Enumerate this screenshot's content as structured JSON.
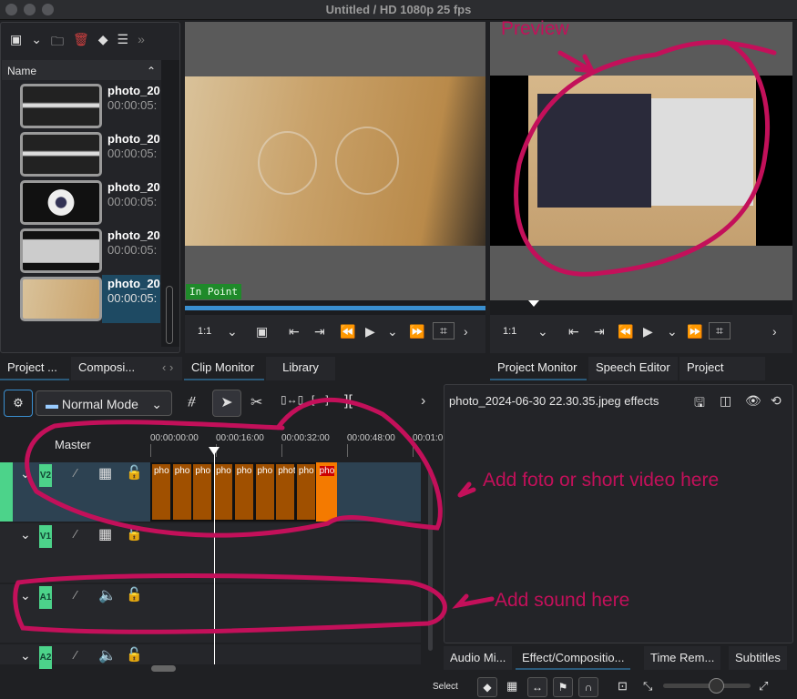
{
  "window": {
    "title": "Untitled / HD 1080p 25 fps"
  },
  "bin": {
    "header": "Name",
    "items": [
      {
        "name": "photo_20",
        "duration": "00:00:05:"
      },
      {
        "name": "photo_20",
        "duration": "00:00:05:"
      },
      {
        "name": "photo_20",
        "duration": "00:00:05:"
      },
      {
        "name": "photo_20",
        "duration": "00:00:05:"
      },
      {
        "name": "photo_20",
        "duration": "00:00:05:",
        "selected": true
      }
    ]
  },
  "left_tabs": [
    "Project ...",
    "Composi...",
    "Clip Monitor",
    "Library"
  ],
  "right_tabs": [
    "Project Monitor",
    "Speech Editor",
    "Project Notes"
  ],
  "clip_monitor": {
    "in_point": "In Point",
    "zoom": "1:1"
  },
  "project_monitor": {
    "zoom": "1:1"
  },
  "timeline": {
    "mode": "Normal Mode",
    "master": "Master",
    "ruler": [
      "00:00:00:00",
      "00:00:16:00",
      "00:00:32:00",
      "00:00:48:00",
      "00:01:0"
    ],
    "tracks": [
      "V2",
      "V1",
      "A1",
      "A2"
    ],
    "clips": [
      "pho",
      "pho",
      "pho",
      "pho",
      "pho",
      "pho",
      "phot",
      "pho",
      "pho"
    ]
  },
  "effects": {
    "title": "photo_2024-06-30 22.30.35.jpeg effects"
  },
  "bottom_tabs": [
    "Audio Mi...",
    "Effect/Compositio...",
    "Time Rem...",
    "Subtitles"
  ],
  "status": {
    "select": "Select",
    "zoom_slider": 0.6
  },
  "annotations": {
    "preview": "Preview",
    "video": "Add foto or short video here",
    "sound": "Add sound here",
    "color": "#c3105a"
  }
}
